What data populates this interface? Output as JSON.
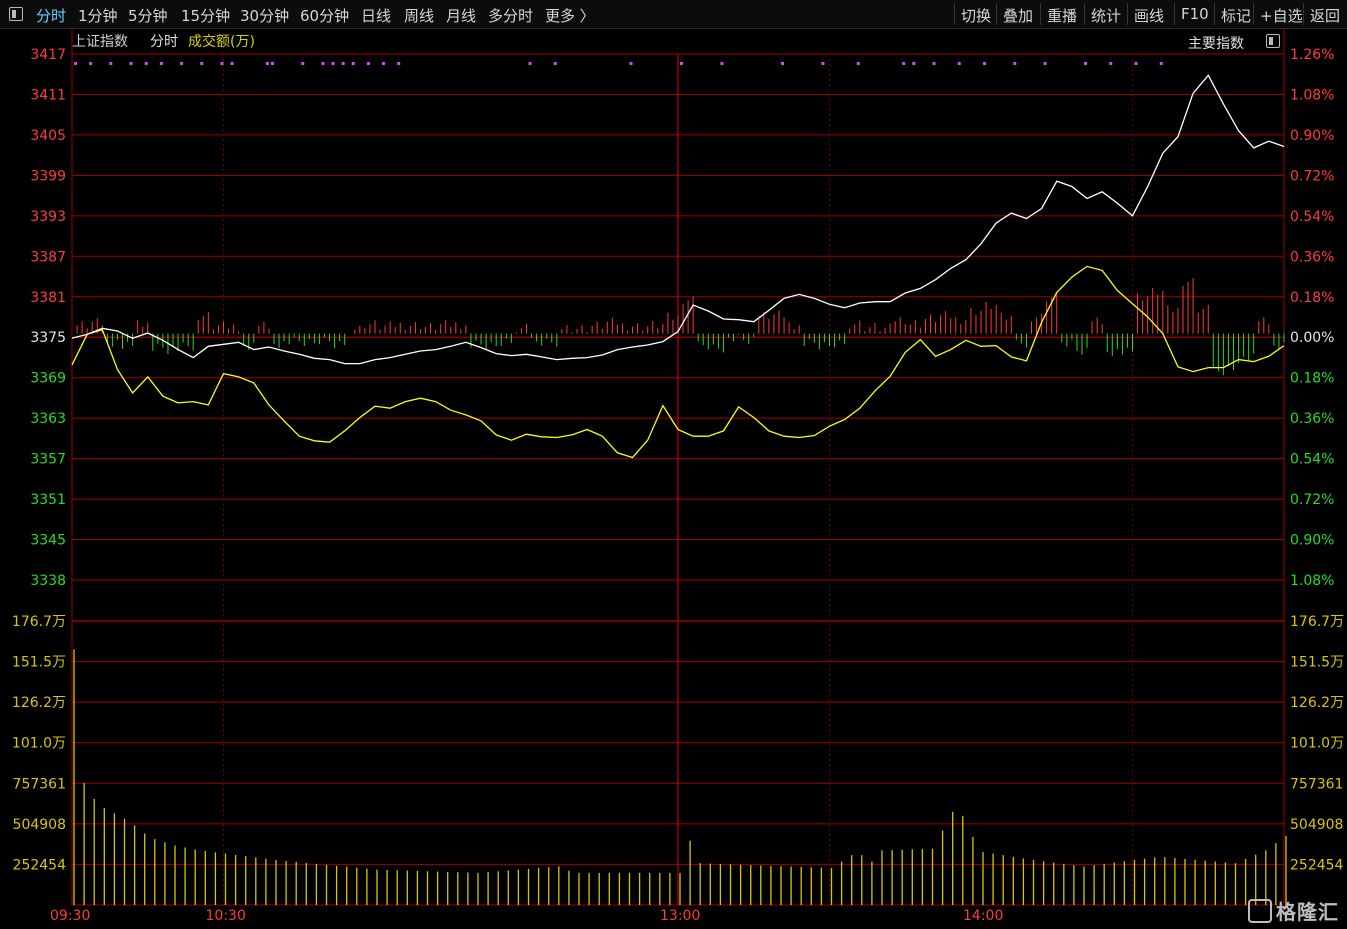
{
  "toolbar": {
    "left_tabs": [
      "分时",
      "1分钟",
      "5分钟",
      "15分钟",
      "30分钟",
      "60分钟",
      "日线",
      "周线",
      "月线",
      "多分时",
      "更多 〉"
    ],
    "active_tab": "分时",
    "right_buttons": [
      "切换",
      "叠加",
      "重播",
      "统计",
      "画线",
      "F10",
      "标记",
      "+自选",
      "返回"
    ]
  },
  "header": {
    "index_name": "上证指数",
    "mode": "分时",
    "volume_label": "成交额(万)",
    "right_label": "主要指数"
  },
  "colors": {
    "up": "#ff3a3a",
    "down": "#22dd22",
    "price_line": "#ffffff",
    "avg_line": "#ffff00",
    "volume": "#d8c700",
    "grid": "#a00000",
    "marker": "#e040ff"
  },
  "chart_data": {
    "type": "line",
    "title": "上证指数 分时",
    "x_axis_ticks": [
      "09:30",
      "10:30",
      "13:00",
      "14:00"
    ],
    "price_axis_left": [
      "3417",
      "3411",
      "3405",
      "3399",
      "3393",
      "3387",
      "3381",
      "3375",
      "3369",
      "3363",
      "3357",
      "3351",
      "3345",
      "3338"
    ],
    "pct_axis_right": [
      "1.26%",
      "1.08%",
      "0.90%",
      "0.72%",
      "0.54%",
      "0.36%",
      "0.18%",
      "0.00%",
      "0.18%",
      "0.36%",
      "0.54%",
      "0.72%",
      "0.90%",
      "1.08%"
    ],
    "prev_close": 3375,
    "ylim": [
      3338,
      3417
    ],
    "volume_axis": [
      "176.7万",
      "151.5万",
      "126.2万",
      "101.0万",
      "757361",
      "504908",
      "252454"
    ],
    "volume_ylim": [
      0,
      1767000
    ],
    "minutes": 240,
    "series": [
      {
        "name": "price",
        "points": [
          [
            0,
            3374.3
          ],
          [
            3,
            3374.9
          ],
          [
            6,
            3375.8
          ],
          [
            9,
            3375.4
          ],
          [
            12,
            3374.3
          ],
          [
            15,
            3375.1
          ],
          [
            18,
            3374.0
          ],
          [
            21,
            3372.6
          ],
          [
            24,
            3371.4
          ],
          [
            27,
            3373.1
          ],
          [
            30,
            3373.4
          ],
          [
            33,
            3373.7
          ],
          [
            36,
            3372.6
          ],
          [
            39,
            3373.0
          ],
          [
            42,
            3372.4
          ],
          [
            45,
            3371.9
          ],
          [
            48,
            3371.3
          ],
          [
            51,
            3371.1
          ],
          [
            54,
            3370.5
          ],
          [
            57,
            3370.5
          ],
          [
            60,
            3371.1
          ],
          [
            63,
            3371.4
          ],
          [
            66,
            3371.9
          ],
          [
            69,
            3372.4
          ],
          [
            72,
            3372.6
          ],
          [
            75,
            3373.1
          ],
          [
            78,
            3373.7
          ],
          [
            81,
            3372.9
          ],
          [
            84,
            3372.0
          ],
          [
            87,
            3371.7
          ],
          [
            90,
            3371.9
          ],
          [
            93,
            3371.5
          ],
          [
            96,
            3371.1
          ],
          [
            99,
            3371.3
          ],
          [
            102,
            3371.4
          ],
          [
            105,
            3371.8
          ],
          [
            108,
            3372.6
          ],
          [
            111,
            3373.0
          ],
          [
            114,
            3373.3
          ],
          [
            117,
            3373.8
          ],
          [
            120,
            3375.3
          ],
          [
            123,
            3379.3
          ],
          [
            126,
            3378.4
          ],
          [
            129,
            3377.2
          ],
          [
            132,
            3377.1
          ],
          [
            135,
            3376.8
          ],
          [
            138,
            3378.5
          ],
          [
            141,
            3380.3
          ],
          [
            144,
            3380.9
          ],
          [
            147,
            3380.3
          ],
          [
            150,
            3379.4
          ],
          [
            153,
            3378.9
          ],
          [
            156,
            3379.6
          ],
          [
            159,
            3379.8
          ],
          [
            162,
            3379.8
          ],
          [
            165,
            3381.1
          ],
          [
            168,
            3381.8
          ],
          [
            171,
            3383.1
          ],
          [
            174,
            3384.8
          ],
          [
            177,
            3386.1
          ],
          [
            180,
            3388.5
          ],
          [
            183,
            3391.6
          ],
          [
            186,
            3393.1
          ],
          [
            189,
            3392.3
          ],
          [
            192,
            3393.8
          ],
          [
            195,
            3397.9
          ],
          [
            198,
            3397.1
          ],
          [
            201,
            3395.3
          ],
          [
            204,
            3396.3
          ],
          [
            207,
            3394.6
          ],
          [
            210,
            3392.7
          ],
          [
            213,
            3397.1
          ],
          [
            216,
            3402.1
          ],
          [
            219,
            3404.6
          ],
          [
            222,
            3411.1
          ],
          [
            225,
            3413.8
          ],
          [
            228,
            3409.5
          ],
          [
            231,
            3405.5
          ],
          [
            234,
            3402.9
          ],
          [
            237,
            3403.9
          ],
          [
            240,
            3403.1
          ]
        ]
      },
      {
        "name": "avg",
        "points": [
          [
            0,
            3370.3
          ],
          [
            3,
            3374.9
          ],
          [
            6,
            3375.6
          ],
          [
            9,
            3369.6
          ],
          [
            12,
            3366.1
          ],
          [
            15,
            3368.5
          ],
          [
            18,
            3365.6
          ],
          [
            21,
            3364.6
          ],
          [
            24,
            3364.8
          ],
          [
            27,
            3364.3
          ],
          [
            30,
            3369.0
          ],
          [
            33,
            3368.5
          ],
          [
            36,
            3367.6
          ],
          [
            39,
            3364.3
          ],
          [
            42,
            3361.9
          ],
          [
            45,
            3359.6
          ],
          [
            48,
            3358.9
          ],
          [
            51,
            3358.7
          ],
          [
            54,
            3360.4
          ],
          [
            57,
            3362.4
          ],
          [
            60,
            3364.1
          ],
          [
            63,
            3363.8
          ],
          [
            66,
            3364.8
          ],
          [
            69,
            3365.3
          ],
          [
            72,
            3364.8
          ],
          [
            75,
            3363.5
          ],
          [
            78,
            3362.8
          ],
          [
            81,
            3361.9
          ],
          [
            84,
            3359.8
          ],
          [
            87,
            3359.0
          ],
          [
            90,
            3359.9
          ],
          [
            93,
            3359.5
          ],
          [
            96,
            3359.4
          ],
          [
            99,
            3359.8
          ],
          [
            102,
            3360.6
          ],
          [
            105,
            3359.6
          ],
          [
            108,
            3357.1
          ],
          [
            111,
            3356.4
          ],
          [
            114,
            3359.0
          ],
          [
            117,
            3364.2
          ],
          [
            120,
            3360.6
          ],
          [
            123,
            3359.6
          ],
          [
            126,
            3359.6
          ],
          [
            129,
            3360.4
          ],
          [
            132,
            3364.0
          ],
          [
            135,
            3362.4
          ],
          [
            138,
            3360.4
          ],
          [
            141,
            3359.6
          ],
          [
            144,
            3359.4
          ],
          [
            147,
            3359.7
          ],
          [
            150,
            3361.1
          ],
          [
            153,
            3362.1
          ],
          [
            156,
            3363.8
          ],
          [
            159,
            3366.4
          ],
          [
            162,
            3368.6
          ],
          [
            165,
            3372.2
          ],
          [
            168,
            3374.1
          ],
          [
            171,
            3371.6
          ],
          [
            174,
            3372.6
          ],
          [
            177,
            3374.0
          ],
          [
            180,
            3373.1
          ],
          [
            183,
            3373.2
          ],
          [
            186,
            3371.5
          ],
          [
            189,
            3370.9
          ],
          [
            192,
            3376.7
          ],
          [
            195,
            3381.2
          ],
          [
            198,
            3383.5
          ],
          [
            201,
            3385.1
          ],
          [
            204,
            3384.5
          ],
          [
            207,
            3381.5
          ],
          [
            210,
            3379.5
          ],
          [
            213,
            3377.5
          ],
          [
            216,
            3375.0
          ],
          [
            219,
            3370.0
          ],
          [
            222,
            3369.3
          ],
          [
            225,
            3369.9
          ],
          [
            228,
            3369.9
          ],
          [
            231,
            3371.1
          ],
          [
            234,
            3370.8
          ],
          [
            237,
            3371.6
          ],
          [
            240,
            3373.2
          ]
        ]
      }
    ],
    "volume_profile": [
      [
        0,
        1590000
      ],
      [
        1,
        930000
      ],
      [
        2,
        760000
      ],
      [
        3,
        700000
      ],
      [
        5,
        620000
      ],
      [
        8,
        570000
      ],
      [
        11,
        520000
      ],
      [
        15,
        420000
      ],
      [
        20,
        370000
      ],
      [
        25,
        340000
      ],
      [
        30,
        320000
      ],
      [
        40,
        280000
      ],
      [
        50,
        250000
      ],
      [
        60,
        220000
      ],
      [
        80,
        200000
      ],
      [
        96,
        240000
      ],
      [
        99,
        200000
      ],
      [
        120,
        200000
      ],
      [
        121,
        470000
      ],
      [
        124,
        260000
      ],
      [
        150,
        230000
      ],
      [
        155,
        330000
      ],
      [
        158,
        270000
      ],
      [
        160,
        340000
      ],
      [
        170,
        350000
      ],
      [
        173,
        520000
      ],
      [
        175,
        640000
      ],
      [
        177,
        470000
      ],
      [
        180,
        330000
      ],
      [
        190,
        280000
      ],
      [
        200,
        240000
      ],
      [
        215,
        300000
      ],
      [
        230,
        260000
      ],
      [
        236,
        340000
      ],
      [
        240,
        430000
      ]
    ],
    "marker_minutes": [
      0,
      3,
      7,
      11,
      14,
      17,
      21,
      25,
      29,
      31,
      38,
      39,
      45,
      49,
      51,
      53,
      55,
      58,
      61,
      64,
      90,
      95,
      110,
      120,
      128,
      140,
      148,
      155,
      164,
      166,
      170,
      175,
      180,
      186,
      192,
      200,
      205,
      210,
      215
    ]
  }
}
